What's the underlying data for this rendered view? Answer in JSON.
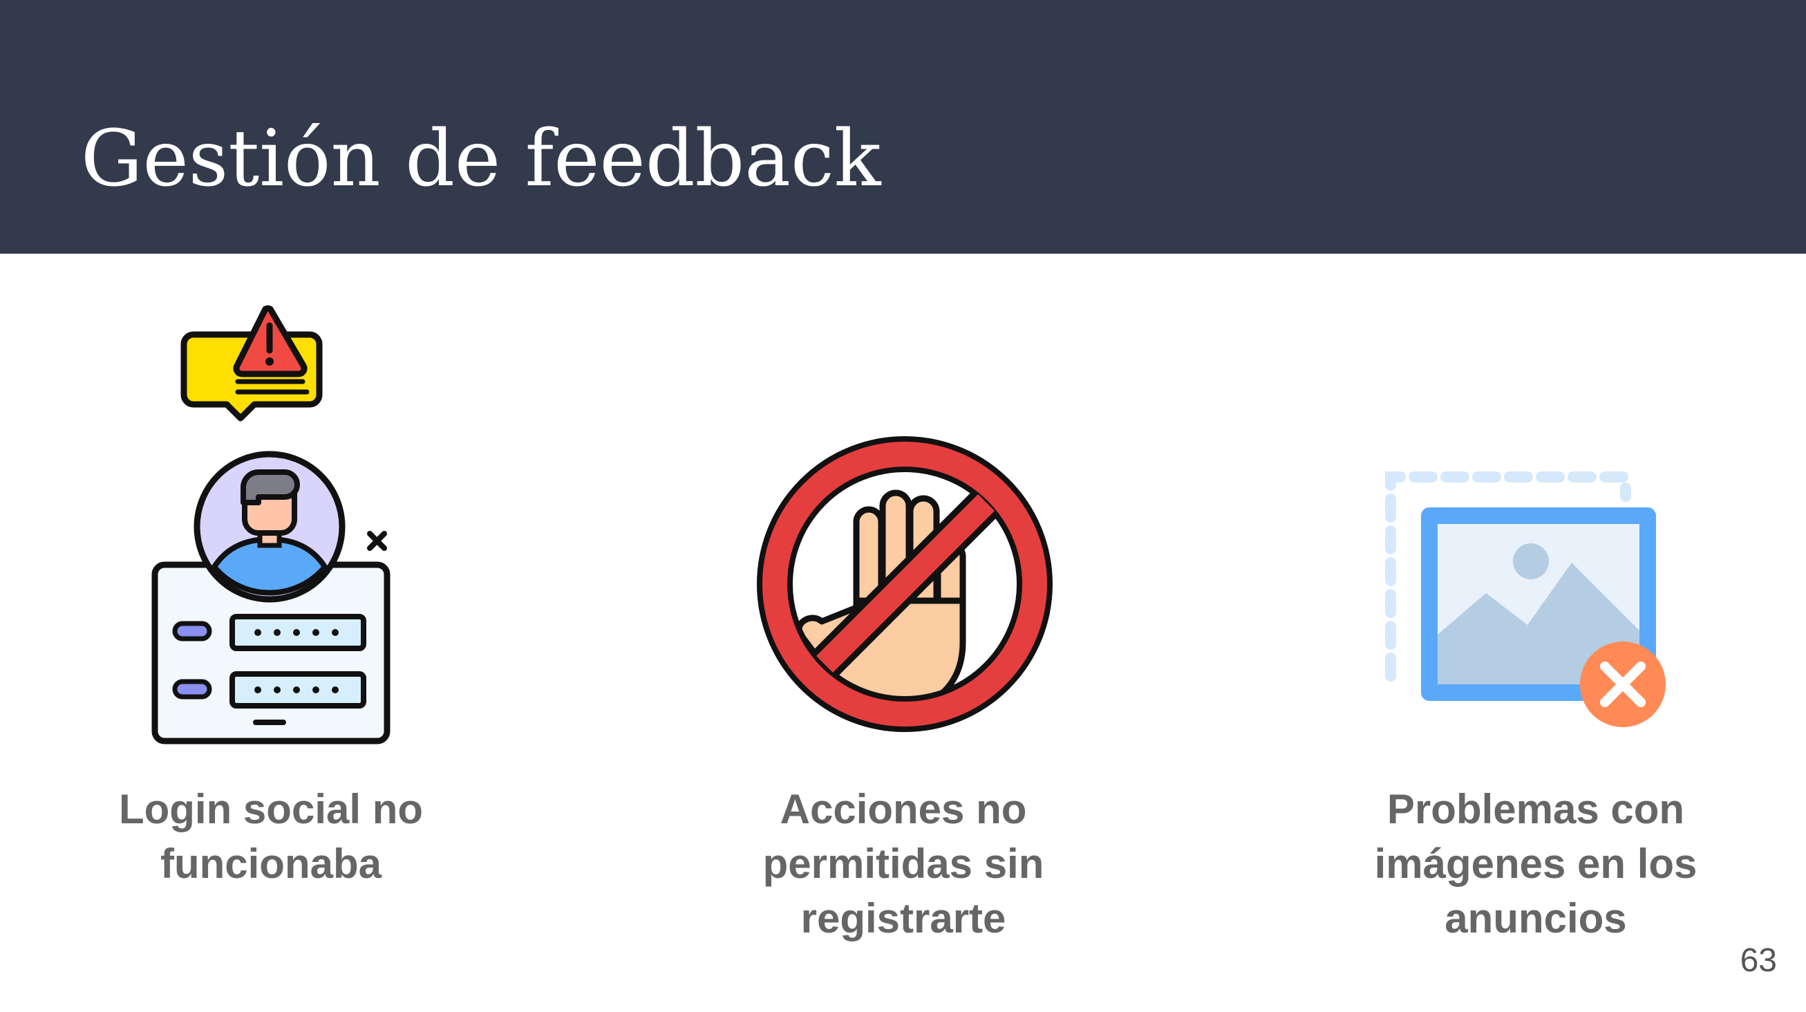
{
  "slide": {
    "title": "Gestión de feedback",
    "page_number": "63"
  },
  "items": [
    {
      "icon": "login-warning-icon",
      "caption_lines": [
        "Login social no",
        "funcionaba"
      ]
    },
    {
      "icon": "prohibited-hand-icon",
      "caption_lines": [
        "Acciones no",
        "permitidas sin",
        "registrarte"
      ]
    },
    {
      "icon": "broken-image-icon",
      "caption_lines": [
        "Problemas con",
        "imágenes en los",
        "anuncios"
      ]
    }
  ],
  "colors": {
    "header_background": "#323a4c",
    "title_text": "#ffffff",
    "caption_text": "#666666",
    "warning_red": "#f04a43",
    "warning_yellow": "#ffdf00",
    "prohibited_red": "#e53e3e",
    "image_blue": "#5aa9f8",
    "error_orange": "#ff8a55"
  }
}
